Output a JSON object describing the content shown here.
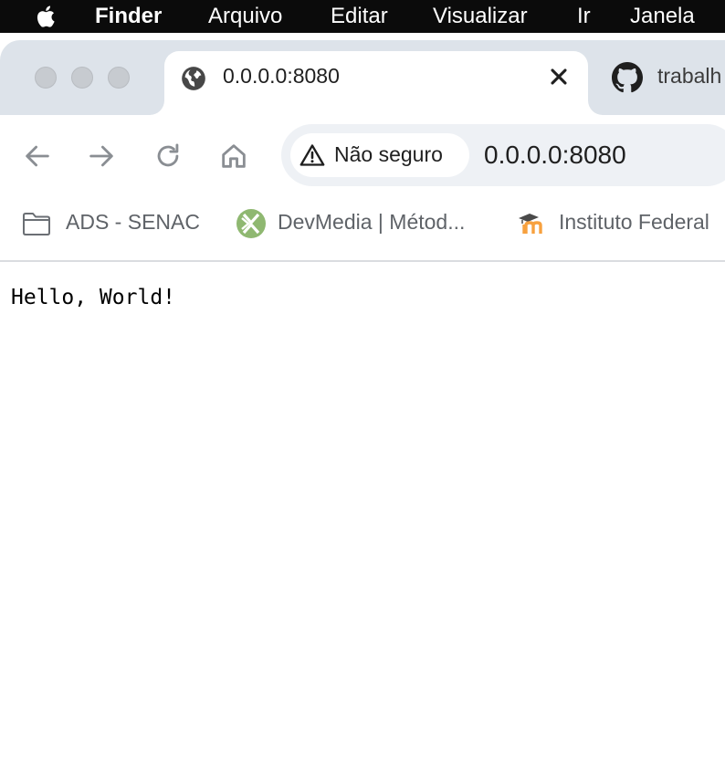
{
  "menubar": {
    "app_name": "Finder",
    "items": [
      "Arquivo",
      "Editar",
      "Visualizar",
      "Ir",
      "Janela"
    ]
  },
  "tabs": [
    {
      "title": "0.0.0.0:8080",
      "icon": "globe-icon",
      "active": true
    },
    {
      "title": "trabalh",
      "icon": "github-icon",
      "active": false
    }
  ],
  "toolbar": {
    "security_label": "Não seguro",
    "url": "0.0.0.0:8080"
  },
  "bookmarks": [
    {
      "label": "ADS - SENAC",
      "icon": "folder-icon"
    },
    {
      "label": "DevMedia | Métod...",
      "icon": "devmedia-icon"
    },
    {
      "label": "Instituto Federal",
      "icon": "moodle-icon"
    }
  ],
  "page": {
    "text": "Hello, World!"
  },
  "colors": {
    "menubar_bg": "#0b0b0b",
    "tabstrip_bg": "#dde3ea",
    "omnibox_bg": "#eef1f5",
    "bookmark_text": "#5f6368",
    "devmedia_green": "#8fb871",
    "moodle_orange": "#f7a13f"
  }
}
